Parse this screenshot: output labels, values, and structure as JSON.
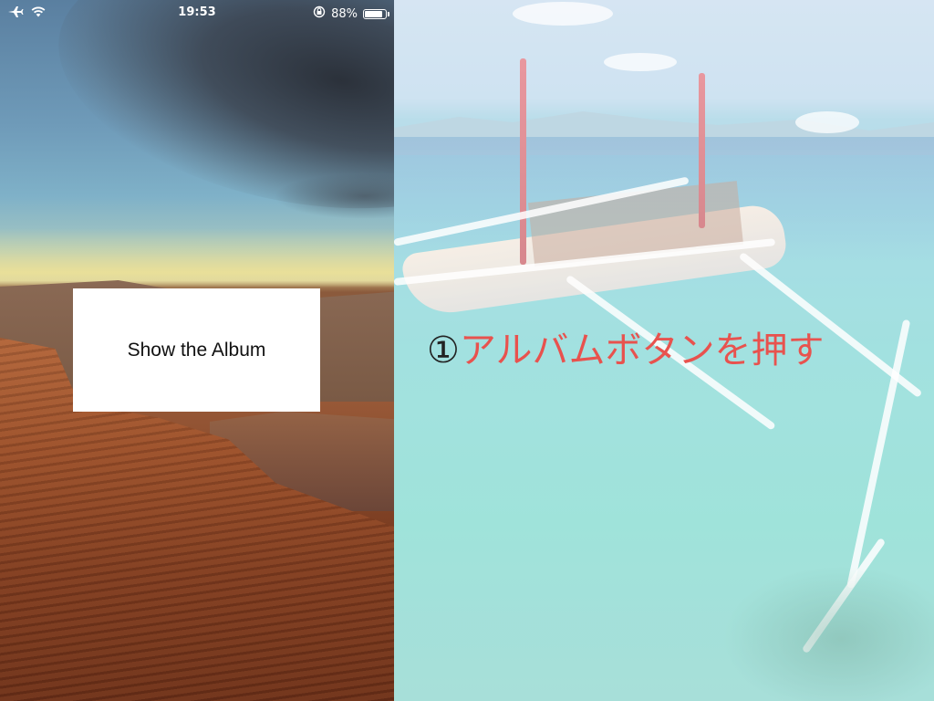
{
  "status_bar": {
    "time": "19:53",
    "battery_percent": "88%",
    "battery_level": 0.88,
    "icons": [
      "airplane-icon",
      "wifi-icon",
      "orientation-lock-icon",
      "battery-icon"
    ]
  },
  "main": {
    "album_button_label": "Show the Album"
  },
  "instruction": {
    "number": "①",
    "text": "アルバムボタンを押す",
    "text_color": "#e8524e"
  },
  "colors": {
    "button_background": "#ffffff",
    "status_text": "#ffffff"
  }
}
